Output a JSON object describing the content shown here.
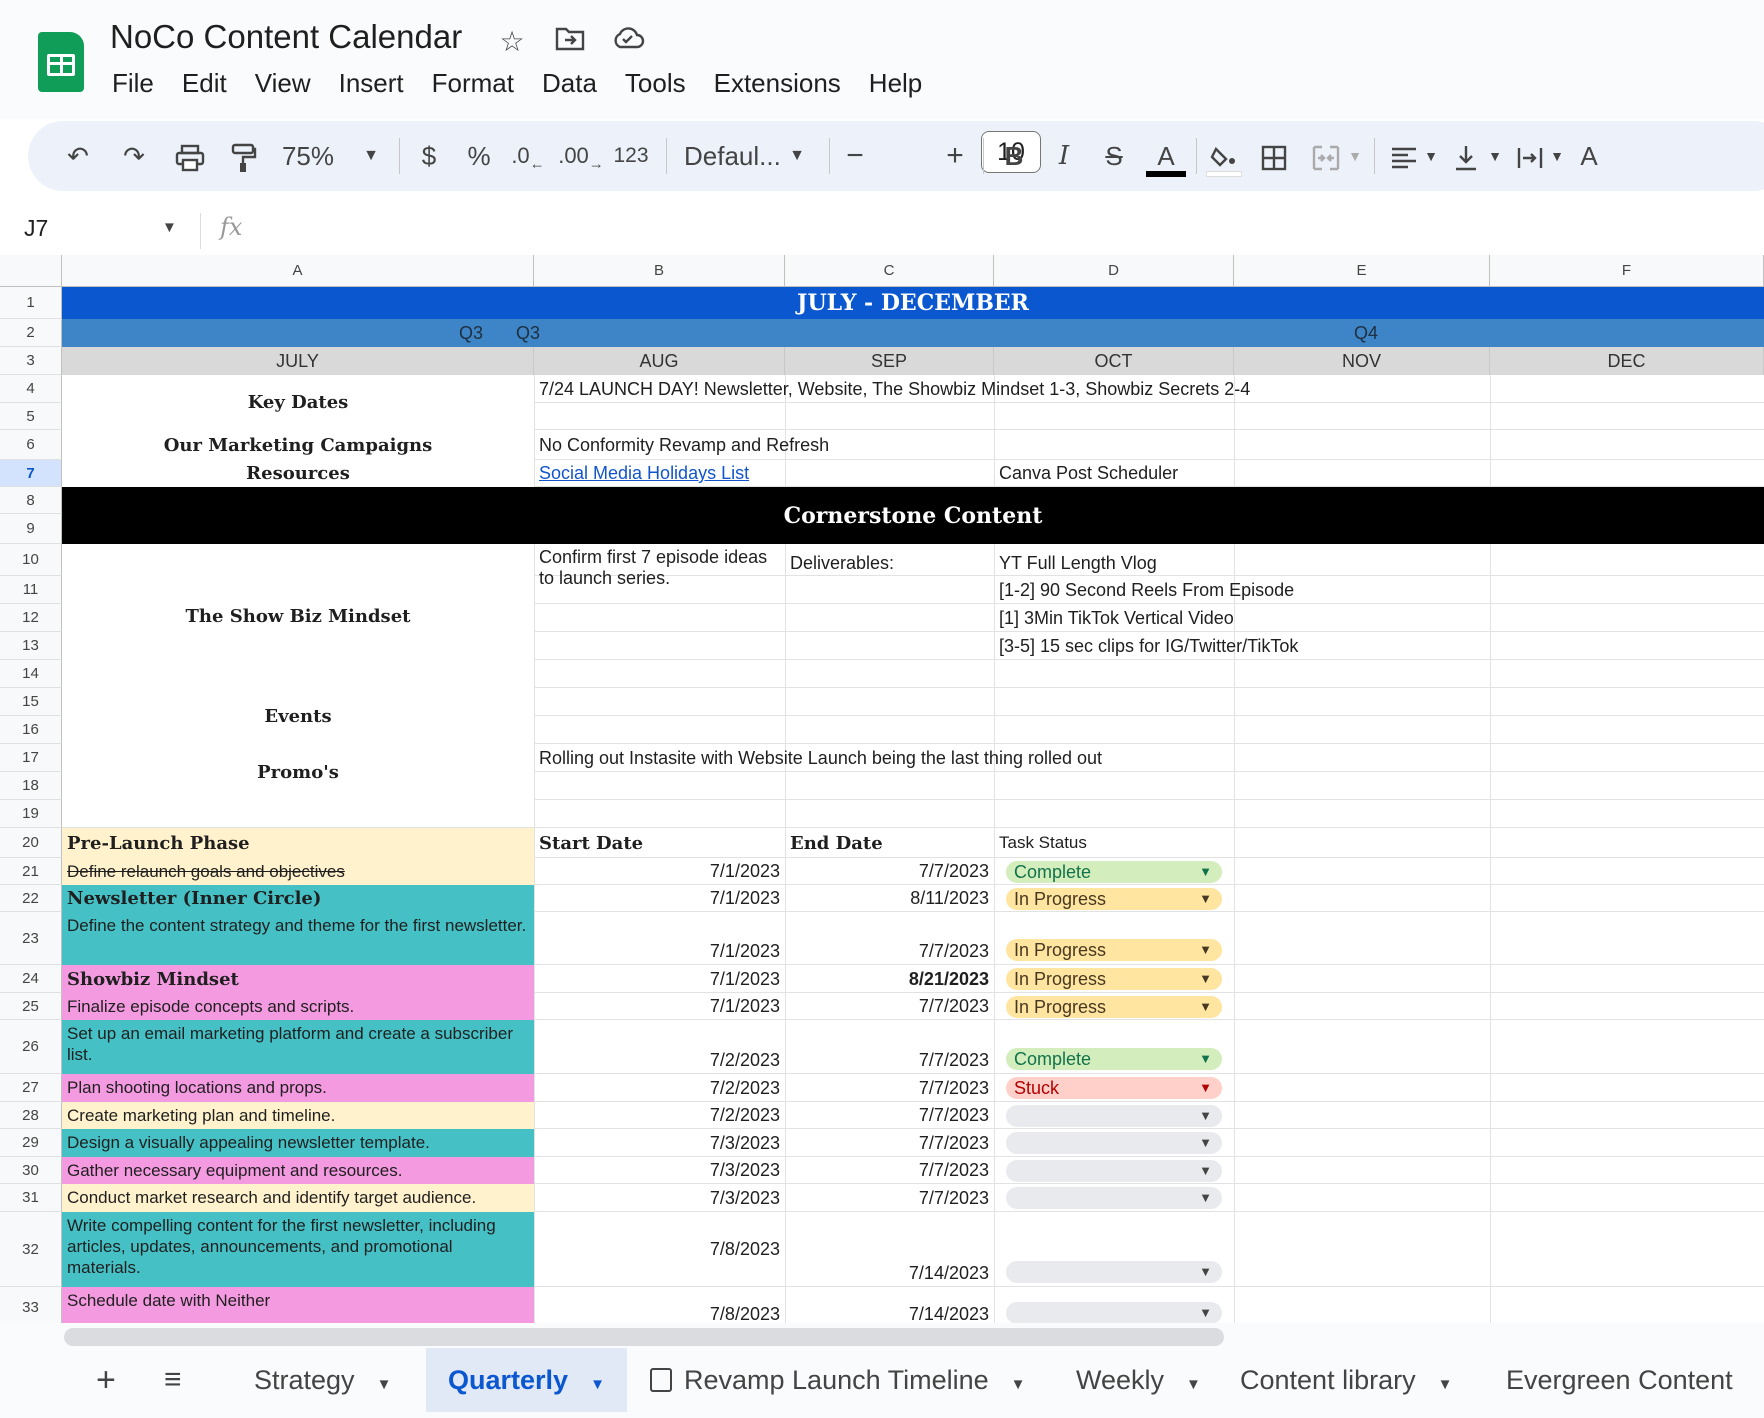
{
  "app": {
    "title": "NoCo Content Calendar"
  },
  "menu": [
    "File",
    "Edit",
    "View",
    "Insert",
    "Format",
    "Data",
    "Tools",
    "Extensions",
    "Help"
  ],
  "toolbar": {
    "zoom": "75%",
    "currency": "$",
    "percent": "%",
    "decimal_less": ".0",
    "decimal_more": ".00",
    "number_format": "123",
    "font": "Defaul...",
    "font_size": "10"
  },
  "formula_bar": {
    "name_box": "J7",
    "fx": "fx",
    "value": ""
  },
  "columns": [
    "A",
    "B",
    "C",
    "D",
    "E",
    "F"
  ],
  "rows": [
    "1",
    "2",
    "3",
    "4",
    "5",
    "6",
    "7",
    "8",
    "9",
    "10",
    "11",
    "12",
    "13",
    "14",
    "15",
    "16",
    "17",
    "18",
    "19",
    "20",
    "21",
    "22",
    "23",
    "24",
    "25",
    "26",
    "27",
    "28",
    "29",
    "30",
    "31",
    "32",
    "33"
  ],
  "cells": {
    "r1_title": "JULY - DECEMBER",
    "r2_q3": "Q3",
    "r2_q4": "Q4",
    "months": [
      "JULY",
      "AUG",
      "SEP",
      "OCT",
      "NOV",
      "DEC"
    ],
    "key_dates": "Key Dates",
    "key_dates_value": "7/24 LAUNCH DAY! Newsletter, Website, The Showbiz Mindset 1-3, Showbiz Secrets 2-4",
    "campaigns": "Our Marketing Campaigns",
    "campaigns_value": "No Conformity Revamp and Refresh",
    "resources": "Resources",
    "resources_link": "Social Media Holidays List",
    "resources_d": "Canva Post Scheduler",
    "cornerstone": "Cornerstone Content",
    "showbiz_mindset": "The Show Biz Mindset",
    "b10": "Confirm first 7 episode ideas to launch series.",
    "c10": "Deliverables:",
    "d10": "YT Full Length Vlog",
    "d11": "[1-2] 90 Second Reels From Episode",
    "d12": "[1] 3Min TikTok Vertical Video",
    "d13": "[3-5] 15 sec clips for IG/Twitter/TikTok",
    "events": "Events",
    "promos": "Promo's",
    "promos_value": "Rolling out Instasite with Website Launch being the last thing rolled out",
    "a20": "Pre-Launch Phase",
    "b20": "Start Date",
    "c20": "End Date",
    "d20": "Task Status"
  },
  "tasks": [
    {
      "name": "Define relaunch goals and objectives",
      "start": "7/1/2023",
      "end": "7/7/2023",
      "status": "Complete"
    },
    {
      "name": "Newsletter (Inner Circle)",
      "start": "7/1/2023",
      "end": "8/11/2023",
      "status": "In Progress"
    },
    {
      "name": "Define the content strategy and theme for the first newsletter.",
      "start": "7/1/2023",
      "end": "7/7/2023",
      "status": "In Progress"
    },
    {
      "name": "Showbiz Mindset",
      "start": "7/1/2023",
      "end": "8/21/2023",
      "status": "In Progress"
    },
    {
      "name": "Finalize episode concepts and scripts.",
      "start": "7/1/2023",
      "end": "7/7/2023",
      "status": "In Progress"
    },
    {
      "name": "Set up an email marketing platform and create a subscriber list.",
      "start": "7/2/2023",
      "end": "7/7/2023",
      "status": "Complete"
    },
    {
      "name": "Plan shooting locations and props.",
      "start": "7/2/2023",
      "end": "7/7/2023",
      "status": "Stuck"
    },
    {
      "name": "Create marketing plan and timeline.",
      "start": "7/2/2023",
      "end": "7/7/2023",
      "status": ""
    },
    {
      "name": "Design a visually appealing newsletter template.",
      "start": "7/3/2023",
      "end": "7/7/2023",
      "status": ""
    },
    {
      "name": "Gather necessary equipment and resources.",
      "start": "7/3/2023",
      "end": "7/7/2023",
      "status": ""
    },
    {
      "name": "Conduct market research and identify target audience.",
      "start": "7/3/2023",
      "end": "7/7/2023",
      "status": ""
    },
    {
      "name": "Write compelling content for the first newsletter, including articles, updates, announcements, and promotional materials.",
      "start": "7/8/2023",
      "end": "7/14/2023",
      "status": ""
    },
    {
      "name": "Schedule date with Neither",
      "start": "7/8/2023",
      "end": "7/14/2023",
      "status": ""
    }
  ],
  "colors": {
    "title_blue": "#0b57d0",
    "quarter_blue": "#3d85c6",
    "month_gray": "#d9d9d9",
    "cream": "#fff2cc",
    "teal": "#45c1c6",
    "pink": "#f49ae1",
    "complete_bg": "#d4edbc",
    "complete_fg": "#11734b",
    "progress_bg": "#ffe5a0",
    "progress_fg": "#473821",
    "stuck_bg": "#ffcfc9",
    "stuck_fg": "#b10202",
    "empty_bg": "#e8eaed"
  },
  "sheet_tabs": [
    "Strategy",
    "Quarterly",
    "Revamp Launch Timeline",
    "Weekly",
    "Content library",
    "Evergreen Content"
  ],
  "active_tab": "Quarterly"
}
